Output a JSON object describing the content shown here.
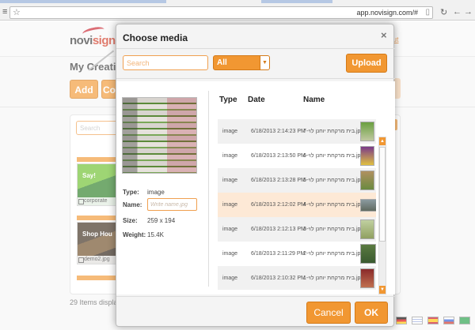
{
  "browser": {
    "url": "app.novisign.com/#",
    "menu_icon": "hamburger-menu-icon",
    "star_icon": "bookmark-star-icon"
  },
  "background": {
    "logo_main": "novi",
    "logo_accent": "sign",
    "title": "My Creati",
    "add_button": "Add",
    "second_button": "Co",
    "search_placeholder": "Search",
    "tiles": [
      {
        "caption": "corporate",
        "overlay": "Say!"
      },
      {
        "caption": "demo2.jpg",
        "overlay": "Shop Hou"
      }
    ],
    "items_count_text": "29 Items displaye",
    "link_text": "ut"
  },
  "modal": {
    "title": "Choose media",
    "close_label": "×",
    "search_placeholder": "Search",
    "filter_value": "All",
    "upload_label": "Upload",
    "details": {
      "type_label": "Type:",
      "type_value": "image",
      "name_label": "Name:",
      "name_placeholder": "Write name.jpg",
      "size_label": "Size:",
      "size_value": "259 x 194",
      "weight_label": "Weight:",
      "weight_value": "15.4K"
    },
    "columns": [
      "Type",
      "Date",
      "Name"
    ],
    "rows": [
      {
        "type": "image",
        "date": "6/18/2013 2:14:23 PM",
        "name": "בית מרקחת יוחנן לוי-7.jpg"
      },
      {
        "type": "image",
        "date": "6/18/2013 2:13:50 PM",
        "name": "בית מרקחת יוחנן לוי-6.jpg"
      },
      {
        "type": "image",
        "date": "6/18/2013 2:13:28 PM",
        "name": "בית מרקחת יוחנן לוי-5.jpg"
      },
      {
        "type": "image",
        "date": "6/18/2013 2:12:02 PM",
        "name": "בית מרקחת יוחנן לוי-4.jpg"
      },
      {
        "type": "image",
        "date": "6/18/2013 2:12:13 PM",
        "name": "בית מרקחת יוחנן לוי-3.jpg"
      },
      {
        "type": "image",
        "date": "6/18/2013 2:11:29 PM",
        "name": "בית מרקחת יוחנן לוי-2.jpg"
      },
      {
        "type": "image",
        "date": "6/18/2013 2:10:32 PM",
        "name": "בית מרקחת יוחנן לוי-1.jpg"
      }
    ],
    "selected_row": 3,
    "cancel_label": "Cancel",
    "ok_label": "OK"
  },
  "colors": {
    "accent": "#f19732",
    "selected_row": "#fde9d6"
  }
}
